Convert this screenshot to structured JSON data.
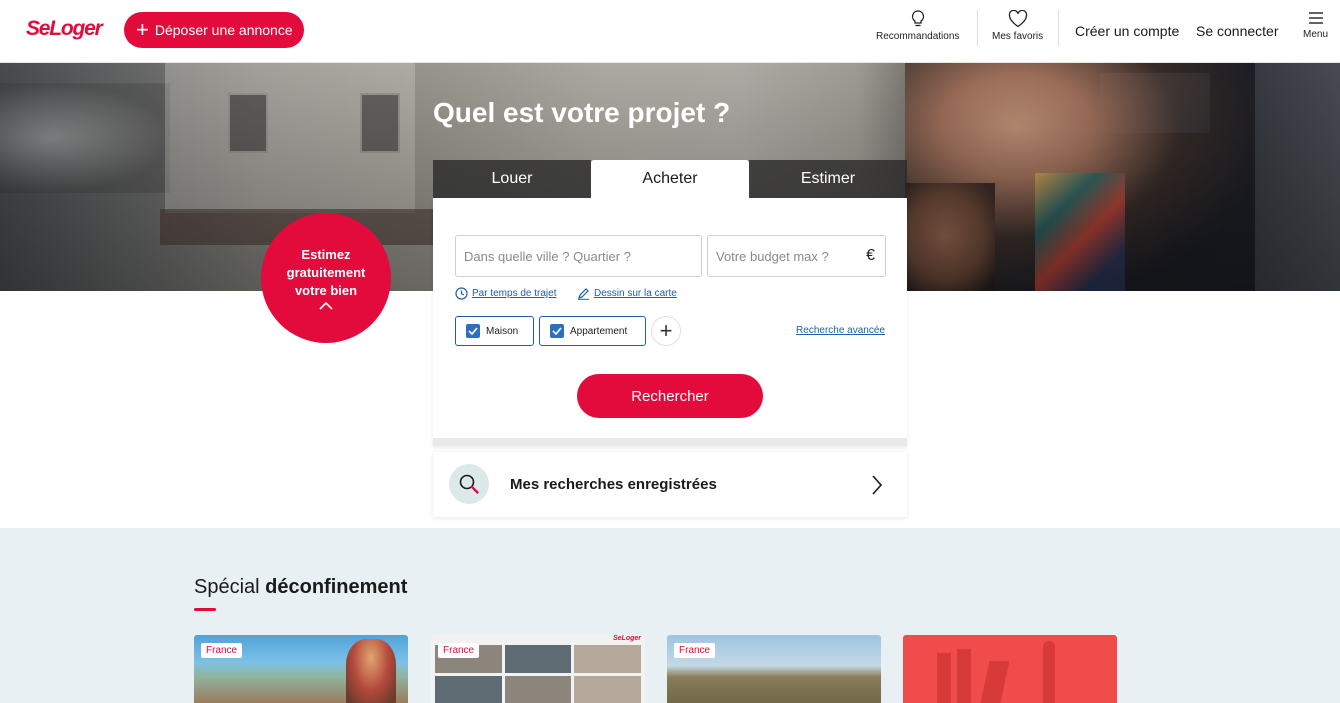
{
  "header": {
    "logo": "SeLoger",
    "post_button": "Déposer une annonce",
    "recommendations": "Recommandations",
    "favorites": "Mes favoris",
    "create_account": "Créer un compte",
    "login": "Se connecter",
    "menu": "Menu"
  },
  "hero": {
    "title": "Quel est votre projet ?"
  },
  "estimate": {
    "line1": "Estimez",
    "line2": "gratuitement",
    "line3": "votre bien"
  },
  "search": {
    "tabs": [
      {
        "label": "Louer",
        "active": false
      },
      {
        "label": "Acheter",
        "active": true
      },
      {
        "label": "Estimer",
        "active": false
      }
    ],
    "city_placeholder": "Dans quelle ville ? Quartier ?",
    "budget_placeholder": "Votre budget max ?",
    "currency": "€",
    "travel_time": "Par temps de trajet",
    "draw_map": "Dessin sur la carte",
    "types": [
      {
        "label": "Maison",
        "checked": true
      },
      {
        "label": "Appartement",
        "checked": true
      }
    ],
    "advanced": "Recherche avancée",
    "submit": "Rechercher"
  },
  "saved_searches": {
    "label": "Mes recherches enregistrées"
  },
  "special": {
    "title_normal": "Spécial ",
    "title_bold": "déconfinement",
    "cards": [
      {
        "badge": "France"
      },
      {
        "badge": "France",
        "logo": "SeLoger"
      },
      {
        "badge": "France"
      },
      {
        "badge": ""
      }
    ]
  },
  "colors": {
    "brand_red": "#e30b3c",
    "link_blue": "#1f5fa8",
    "section_bg": "#e8f0f4"
  }
}
